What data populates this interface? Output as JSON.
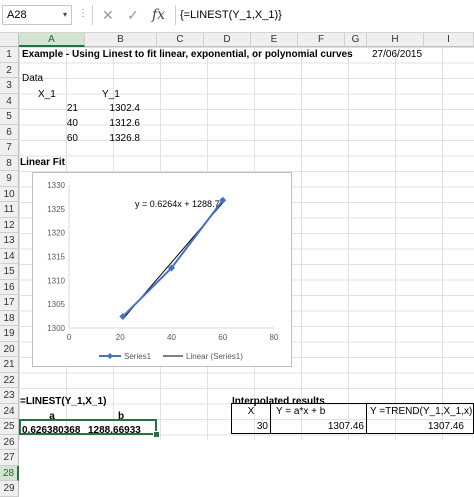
{
  "formula_bar": {
    "name_box": "A28",
    "cancel_icon": "✕",
    "enter_icon": "✓",
    "fx_label": "fx",
    "formula": "{=LINEST(Y_1,X_1)}"
  },
  "columns": [
    "A",
    "B",
    "C",
    "D",
    "E",
    "F",
    "G",
    "H",
    "I"
  ],
  "rows": [
    "1",
    "2",
    "3",
    "4",
    "5",
    "6",
    "7",
    "8",
    "9",
    "10",
    "11",
    "12",
    "13",
    "14",
    "15",
    "16",
    "17",
    "18",
    "19",
    "20",
    "21",
    "22",
    "23",
    "24",
    "25",
    "26",
    "27",
    "28",
    "29"
  ],
  "cells": {
    "title": "Example - Using Linest to fit linear, exponential, or polynomial curves",
    "date": "27/06/2015",
    "data_label": "Data",
    "x_header": "X_1",
    "y_header": "Y_1",
    "x_values": [
      "21",
      "40",
      "60"
    ],
    "y_values": [
      "1302.4",
      "1312.6",
      "1326.8"
    ],
    "linear_fit": "Linear Fit",
    "linest_label": "=LINEST(Y_1,X_1)",
    "a_label": "a",
    "b_label": "b",
    "a_value": "0.626380368",
    "b_value": "1288.66933",
    "interp_title": "Interpolated results",
    "interp_headers": [
      "X",
      "Y = a*x + b",
      "Y =TREND(Y_1,X_1,x)"
    ],
    "interp_values": [
      "30",
      "1307.46",
      "1307.46"
    ]
  },
  "colors": {
    "accent": "#217346",
    "series": "#4472c4",
    "trend": "#000000"
  },
  "chart_data": {
    "type": "scatter",
    "title": "",
    "xlim": [
      0,
      80
    ],
    "ylim": [
      1300,
      1330
    ],
    "x_ticks": [
      "0",
      "20",
      "40",
      "60",
      "80"
    ],
    "y_ticks": [
      "1300",
      "1305",
      "1310",
      "1315",
      "1320",
      "1325",
      "1330"
    ],
    "series": [
      {
        "name": "Series1",
        "x": [
          21,
          40,
          60
        ],
        "y": [
          1302.4,
          1312.6,
          1326.8
        ]
      }
    ],
    "trendline": {
      "name": "Linear (Series1)",
      "slope": 0.6264,
      "intercept": 1288.7,
      "equation": "y = 0.6264x + 1288.7"
    },
    "legend": "bottom",
    "grid": false
  }
}
